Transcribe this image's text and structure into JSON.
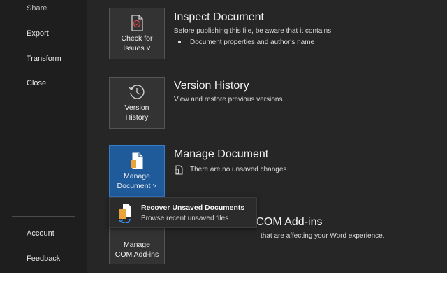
{
  "sidebar": {
    "items": [
      {
        "label": "Share"
      },
      {
        "label": "Export"
      },
      {
        "label": "Transform"
      },
      {
        "label": "Close"
      },
      {
        "label": "Account"
      },
      {
        "label": "Feedback"
      }
    ]
  },
  "inspect": {
    "tile_label": "Check for\nIssues ˅",
    "title": "Inspect Document",
    "desc": "Before publishing this file, be aware that it contains:",
    "bullet": "Document properties and author's name",
    "icon": "check-document-icon"
  },
  "version": {
    "tile_label": "Version\nHistory",
    "title": "Version History",
    "desc": "View and restore previous versions.",
    "icon": "clock-history-icon"
  },
  "manage_document": {
    "tile_label": "Manage\nDocument ˅",
    "title": "Manage Document",
    "desc": "There are no unsaved changes.",
    "icon": "document-icon"
  },
  "com_addins": {
    "tile_label": "Manage\nCOM Add-ins",
    "title_visible": "d COM Add-ins",
    "desc_visible": "that are affecting your Word experience."
  },
  "popup": {
    "title": "Recover Unsaved Documents",
    "subtitle": "Browse recent unsaved files",
    "icon": "recover-documents-icon"
  },
  "colors": {
    "background": "#262626",
    "sidebar": "#1e1e1e",
    "accent": "#1f5a9b",
    "tile": "#333333"
  }
}
